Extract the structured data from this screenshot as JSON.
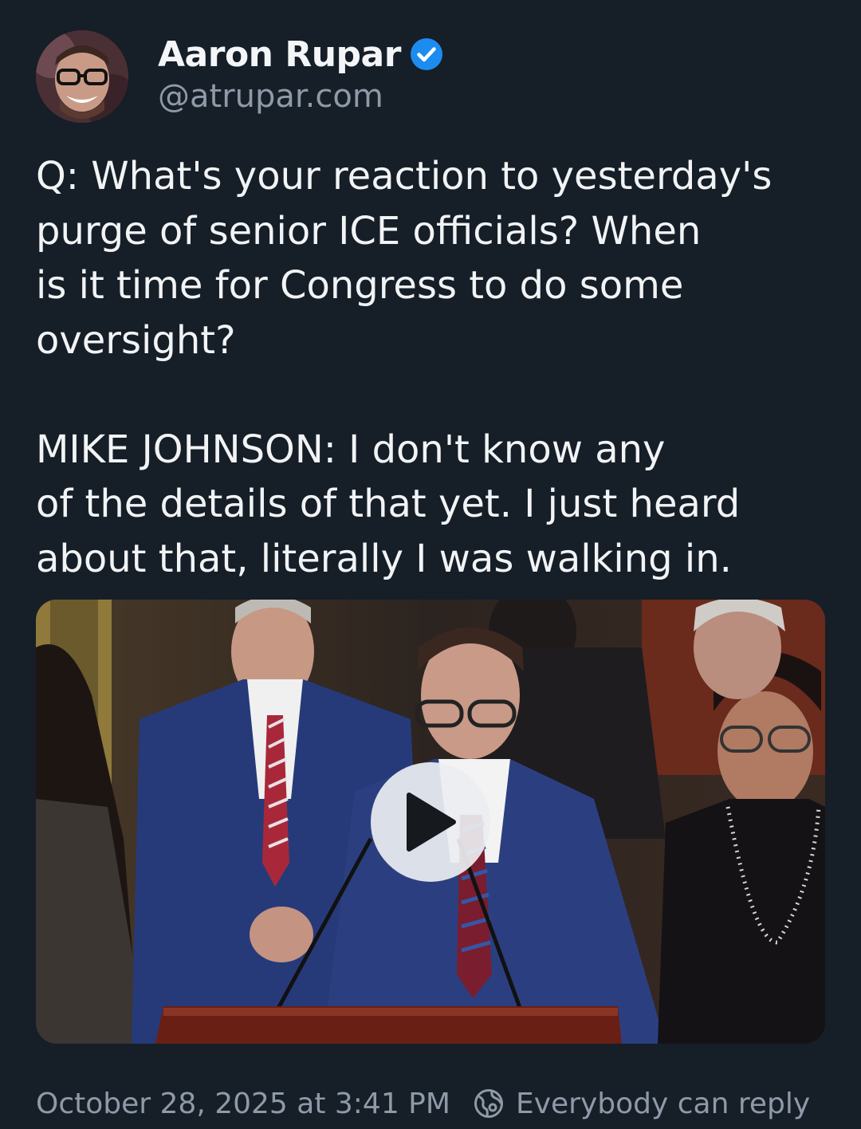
{
  "post": {
    "author": {
      "display_name": "Aaron Rupar",
      "handle": "@atrupar.com",
      "verified": true,
      "avatar_icon": "avatar-photo"
    },
    "text": "Q: What's your reaction to yesterday's\npurge of senior ICE officials? When\nis it time for Congress to do some\noversight?\n\nMIKE JOHNSON: I don't know any\nof the details of that yet. I just heard\nabout that, literally I was walking in.",
    "media": {
      "type": "video",
      "play_icon": "play-icon"
    },
    "timestamp": "October 28, 2025 at 3:41 PM",
    "reply_setting": {
      "icon": "globe-reply-icon",
      "label": "Everybody can reply"
    }
  },
  "colors": {
    "background": "#161e27",
    "text": "#f1f3f5",
    "muted": "#8e9aa8",
    "verified": "#1d8cf0"
  }
}
